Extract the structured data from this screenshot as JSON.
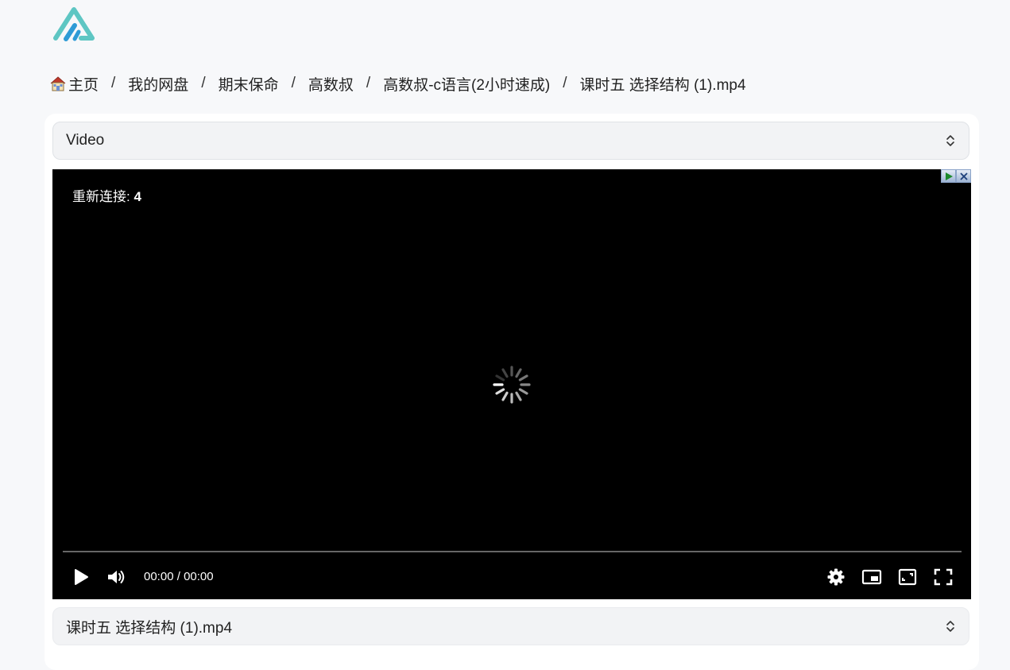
{
  "breadcrumb": {
    "home": "主页",
    "separator": "/",
    "items": [
      "我的网盘",
      "期末保命",
      "高数叔",
      "高数叔-c语言(2小时速成)",
      "课时五 选择结构 (1).mp4"
    ]
  },
  "top_select": {
    "value": "Video"
  },
  "player": {
    "reconnect_label": "重新连接:",
    "reconnect_count": "4",
    "time_current": "00:00",
    "time_separator": " / ",
    "time_total": "00:00",
    "progress": 0
  },
  "bottom_select": {
    "value": "课时五 选择结构 (1).mp4"
  },
  "colors": {
    "background": "#f7f8fa",
    "logo_teal": "#5ec6c3",
    "logo_blue": "#2e9bd6",
    "video_bg": "#000000"
  },
  "icons": {
    "logo": "logo-mountain-icon",
    "home": "house-icon",
    "play": "play-icon",
    "volume": "volume-icon",
    "settings": "gear-icon",
    "pip": "picture-in-picture-icon",
    "theater": "theater-mode-icon",
    "fullscreen": "fullscreen-icon"
  }
}
